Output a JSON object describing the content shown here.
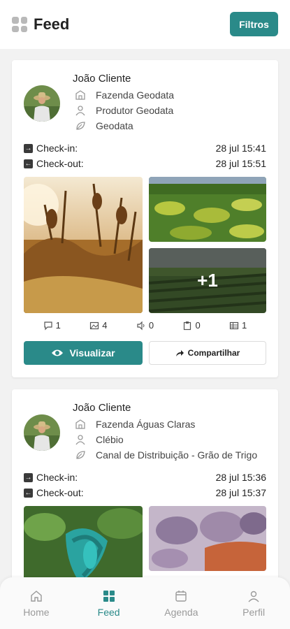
{
  "header": {
    "title": "Feed",
    "filter_label": "Filtros"
  },
  "colors": {
    "accent": "#2a8a89"
  },
  "posts": [
    {
      "user": "João Cliente",
      "farm": "Fazenda Geodata",
      "producer": "Produtor Geodata",
      "crop": "Geodata",
      "checkin_label": "Check-in:",
      "checkin": "28 jul 15:41",
      "checkout_label": "Check-out:",
      "checkout": "28 jul 15:51",
      "more_photos": "+1",
      "stats": {
        "comments": "1",
        "images": "4",
        "audios": "0",
        "documents": "0",
        "tables": "1"
      },
      "view_label": "Visualizar",
      "share_label": "Compartilhar"
    },
    {
      "user": "João Cliente",
      "farm": "Fazenda Águas Claras",
      "producer": "Clébio",
      "crop": "Canal de Distribuição - Grão de Trigo",
      "checkin_label": "Check-in:",
      "checkin": "28 jul 15:36",
      "checkout_label": "Check-out:",
      "checkout": "28 jul 15:37"
    }
  ],
  "tabs": [
    {
      "label": "Home",
      "icon": "home-icon"
    },
    {
      "label": "Feed",
      "icon": "grid-icon",
      "active": true
    },
    {
      "label": "Agenda",
      "icon": "calendar-icon"
    },
    {
      "label": "Perfil",
      "icon": "user-icon"
    }
  ]
}
